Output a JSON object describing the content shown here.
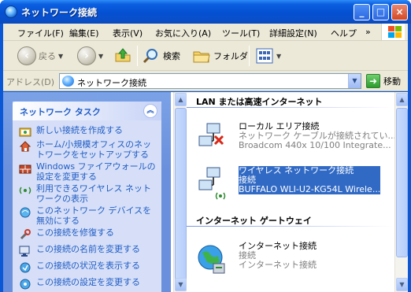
{
  "window": {
    "title": "ネットワーク接続",
    "controls": {
      "minimize": "_",
      "maximize": "□",
      "close": "×"
    }
  },
  "menu": {
    "items": [
      "ファイル(F)",
      "編集(E)",
      "表示(V)",
      "お気に入り(A)",
      "ツール(T)",
      "詳細設定(N)",
      "ヘルプ"
    ],
    "overflow": "»"
  },
  "toolbar": {
    "back_label": "戻る",
    "search_label": "検索",
    "folders_label": "フォルダ"
  },
  "address": {
    "label": "アドレス(D)",
    "value": "ネットワーク接続",
    "go_label": "移動"
  },
  "taskpane": {
    "header": "ネットワーク タスク",
    "tasks": [
      {
        "label": "新しい接続を作成する",
        "icon": "new-connection-icon"
      },
      {
        "label": "ホーム/小規模オフィスのネットワークをセットアップする",
        "icon": "home-network-icon"
      },
      {
        "label": "Windows ファイアウォールの設定を変更する",
        "icon": "firewall-icon"
      },
      {
        "label": "利用できるワイヤレス ネットワークの表示",
        "icon": "wireless-icon"
      },
      {
        "label": "このネットワーク デバイスを無効にする",
        "icon": "disable-device-icon"
      },
      {
        "label": "この接続を修復する",
        "icon": "repair-icon"
      },
      {
        "label": "この接続の名前を変更する",
        "icon": "rename-icon"
      },
      {
        "label": "この接続の状況を表示する",
        "icon": "status-icon"
      },
      {
        "label": "この接続の設定を変更する",
        "icon": "settings-icon"
      }
    ]
  },
  "groups": [
    {
      "header": "LAN または高速インターネット",
      "connections": [
        {
          "name": "ローカル エリア接続",
          "status": "ネットワーク ケーブルが接続されてい...",
          "device": "Broadcom 440x 10/100 Integrate...",
          "selected": false,
          "icon": "lan-disconnected-icon"
        },
        {
          "name": "ワイヤレス ネットワーク接続",
          "status": "接続",
          "device": "BUFFALO WLI-U2-KG54L Wirele...",
          "selected": true,
          "icon": "wireless-connected-icon"
        }
      ]
    },
    {
      "header": "インターネット ゲートウェイ",
      "connections": [
        {
          "name": "インターネット接続",
          "status": "接続",
          "device": "インターネット接続",
          "selected": false,
          "icon": "internet-gateway-icon"
        }
      ]
    }
  ],
  "colors": {
    "titlebar": "#0450d2",
    "taskpane_bg": "#6a8fdc",
    "task_link": "#215dc6",
    "selection": "#316ac5"
  }
}
